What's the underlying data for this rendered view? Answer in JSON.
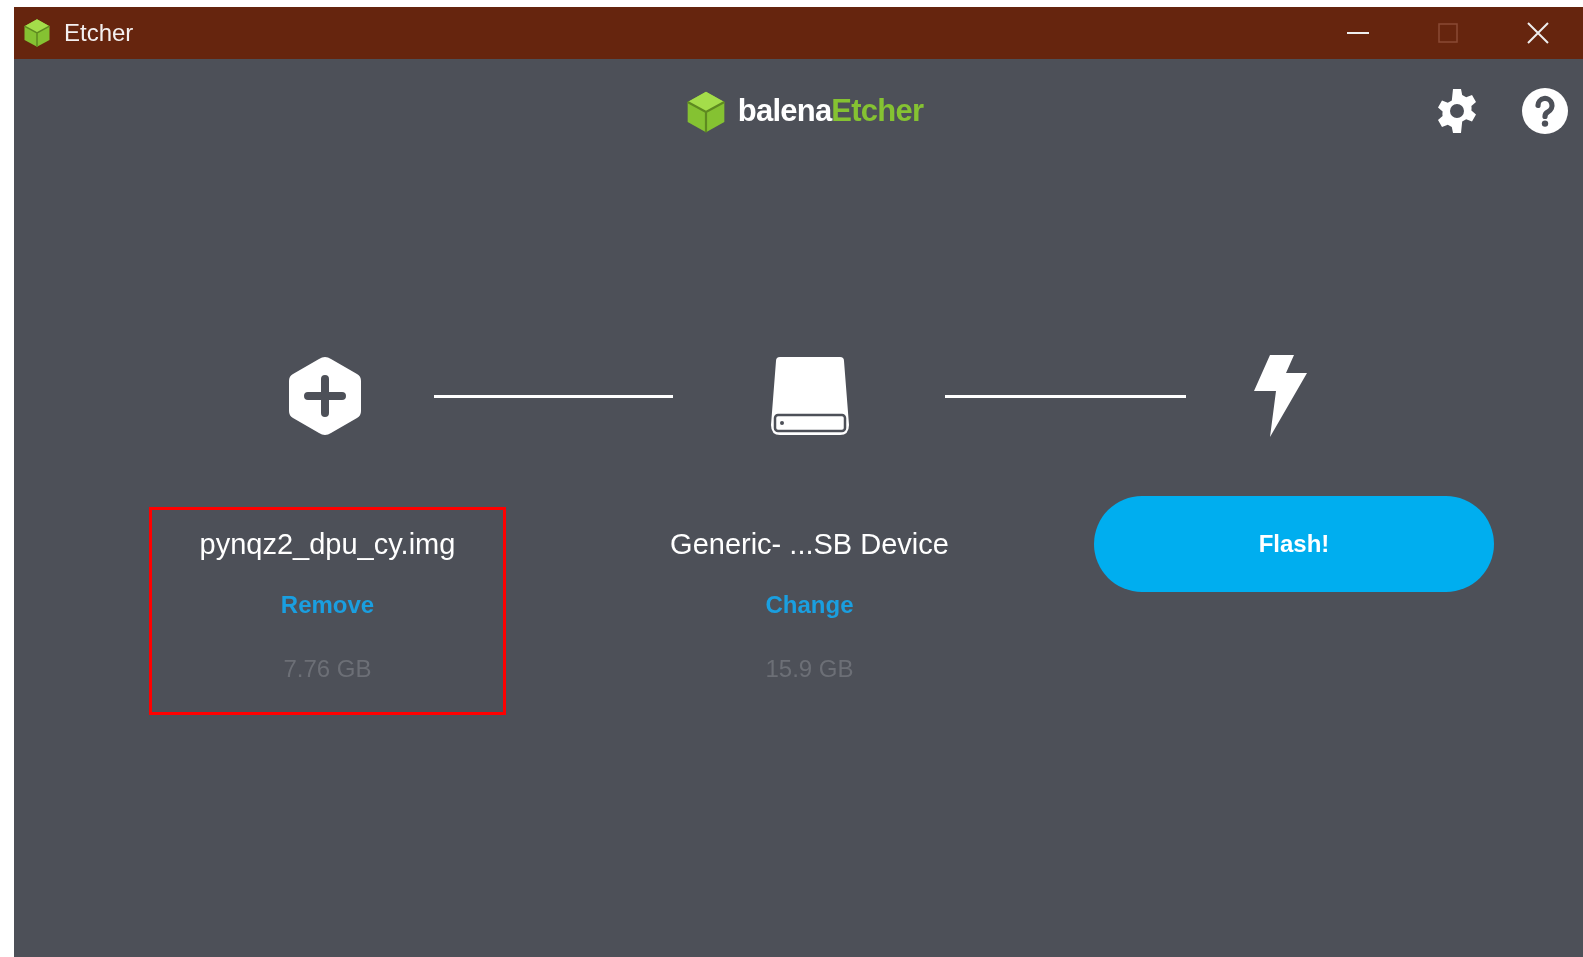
{
  "window": {
    "title": "Etcher"
  },
  "logo": {
    "brand": "balena",
    "product": "Etcher"
  },
  "steps": [
    {
      "kind": "source",
      "name": "pynqz2_dpu_cy.img",
      "action": "Remove",
      "size": "7.76 GB",
      "highlighted": true
    },
    {
      "kind": "target",
      "name": "Generic- ...SB Device",
      "action": "Change",
      "size": "15.9 GB",
      "highlighted": false
    }
  ],
  "flash_button": {
    "label": "Flash!"
  }
}
